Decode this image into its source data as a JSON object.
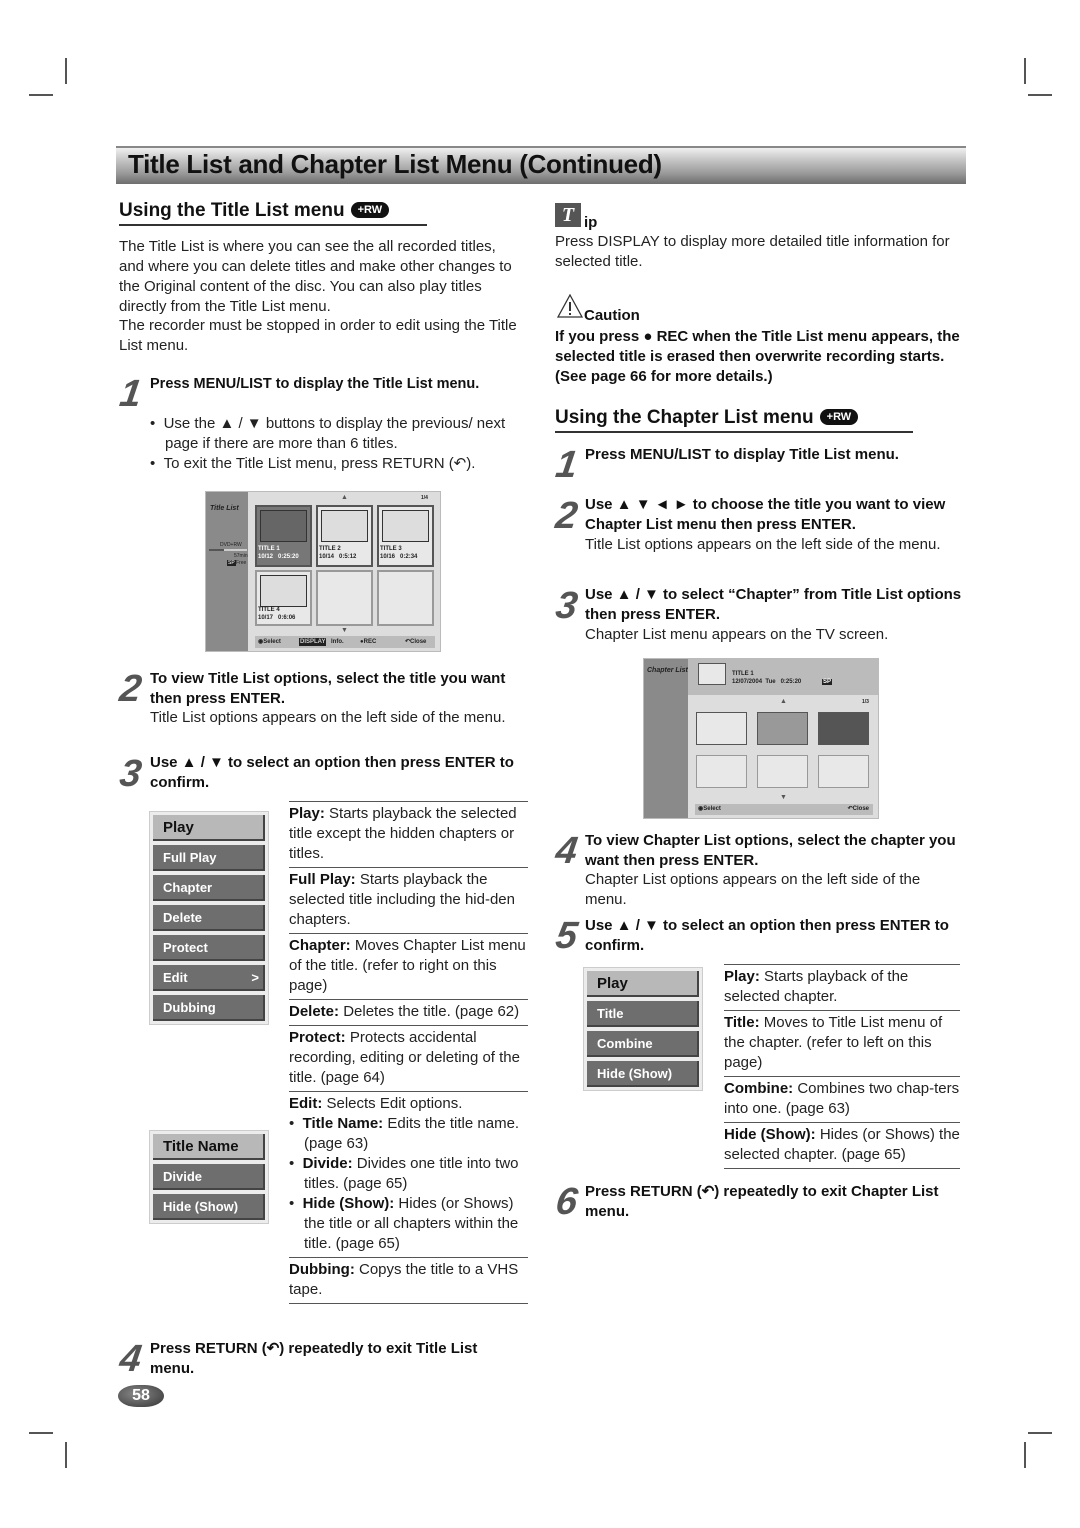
{
  "banner_title": "Title List and Chapter List Menu (Continued)",
  "badge_rw": "+RW",
  "left": {
    "heading": "Using the Title List menu",
    "intro": "The Title List is where you can see the all recorded titles, and where you can delete titles and make other changes to the Original content of the disc. You can also play titles directly from the Title List menu.",
    "intro2": "The recorder must be stopped in order to edit using the Title List menu.",
    "step1_num": "1",
    "step1": "Press MENU/LIST to display the Title List menu.",
    "step1_bullets": [
      "Use the ▲ / ▼ buttons to display the previous/ next page if there are more than 6 titles.",
      "To exit the Title List menu, press RETURN (↶)."
    ],
    "osd": {
      "label": "Title List",
      "disc": "DVD+RW",
      "remain": "57min",
      "sp": "SP",
      "free": "Free",
      "page": "1/4",
      "titles": [
        {
          "name": "TITLE 1",
          "date": "10/12",
          "time": "0:25:20",
          "selected": true
        },
        {
          "name": "TITLE 2",
          "date": "10/14",
          "time": "0:5:12"
        },
        {
          "name": "TITLE 3",
          "date": "10/16",
          "time": "0:2:34"
        },
        {
          "name": "TITLE 4",
          "date": "10/17",
          "time": "0:6:06"
        }
      ],
      "footer": {
        "select": "Select",
        "display": "DISPLAY",
        "info": "Info.",
        "rec": "REC",
        "close": "Close"
      }
    },
    "step2_num": "2",
    "step2": "To view Title List options, select the title you want then press ENTER.",
    "step2_sub": "Title List options appears on the left side of the menu.",
    "step3_num": "3",
    "step3": "Use ▲ / ▼ to select an option then press ENTER to confirm.",
    "menu1": [
      "Play",
      "Full Play",
      "Chapter",
      "Delete",
      "Protect",
      "Edit",
      "Dubbing"
    ],
    "edit_arrow": ">",
    "menu2": [
      "Title Name",
      "Divide",
      "Hide (Show)"
    ],
    "descs": [
      {
        "term": "Play:",
        "text": " Starts playback the selected title except the hidden chapters or titles."
      },
      {
        "term": "Full Play:",
        "text": " Starts playback the selected title including the hid-den chapters."
      },
      {
        "term": "Chapter:",
        "text": " Moves Chapter List menu of the title. (refer to right on this page)"
      },
      {
        "term": "Delete:",
        "text": " Deletes the title. (page 62)"
      },
      {
        "term": "Protect:",
        "text": " Protects accidental recording, editing or deleting of the title. (page 64)"
      },
      {
        "term": "Edit:",
        "text": " Selects Edit options."
      },
      {
        "term": "Dubbing:",
        "text": " Copys the title to a VHS tape."
      }
    ],
    "edit_bullets": [
      {
        "term": "Title Name:",
        "text": " Edits the title name. (page 63)"
      },
      {
        "term": "Divide:",
        "text": " Divides one title into two titles. (page 65)"
      },
      {
        "term": "Hide (Show):",
        "text": " Hides (or Shows) the title or all chapters within the title. (page 65)"
      }
    ],
    "step4_num": "4",
    "step4": "Press RETURN (↶) repeatedly to exit Title List menu."
  },
  "right": {
    "tip_label": "ip",
    "tip_text": "Press DISPLAY to display more detailed title information for selected title.",
    "caution_label": "Caution",
    "caution_text": "If you press ● REC when the Title List menu appears, the selected title is erased then overwrite recording starts. (See page 66 for more details.)",
    "heading": "Using the Chapter List menu",
    "step1_num": "1",
    "step1": "Press MENU/LIST to display Title List menu.",
    "step2_num": "2",
    "step2": "Use ▲ ▼ ◄ ► to choose the title you want to view Chapter List menu then press ENTER.",
    "step2_sub": "Title List options appears on the left side of the menu.",
    "step3_num": "3",
    "step3": "Use ▲ / ▼ to select “Chapter” from Title List options then press ENTER.",
    "step3_sub": "Chapter List menu appears on the TV screen.",
    "osd": {
      "label": "Chapter List",
      "title": "TITLE 1",
      "info": "12/07/2004  Tue   0:25:20",
      "sp": "SP",
      "page": "1/3",
      "footer": {
        "select": "Select",
        "close": "Close"
      }
    },
    "step4_num": "4",
    "step4": "To view Chapter List options, select the chapter you want then press ENTER.",
    "step4_sub": "Chapter List options appears on the left side of the menu.",
    "step5_num": "5",
    "step5": "Use ▲ / ▼ to select an option then press ENTER to confirm.",
    "menu": [
      "Play",
      "Title",
      "Combine",
      "Hide (Show)"
    ],
    "descs": [
      {
        "term": "Play:",
        "text": " Starts playback of the selected chapter."
      },
      {
        "term": "Title:",
        "text": " Moves to Title List menu of the chapter. (refer to left on this page)"
      },
      {
        "term": "Combine:",
        "text": " Combines two chap-ters into one. (page 63)"
      },
      {
        "term": "Hide (Show):",
        "text": " Hides (or Shows) the selected chapter. (page 65)"
      }
    ],
    "step6_num": "6",
    "step6": "Press RETURN (↶) repeatedly to exit Chapter List menu."
  },
  "page_number": "58"
}
